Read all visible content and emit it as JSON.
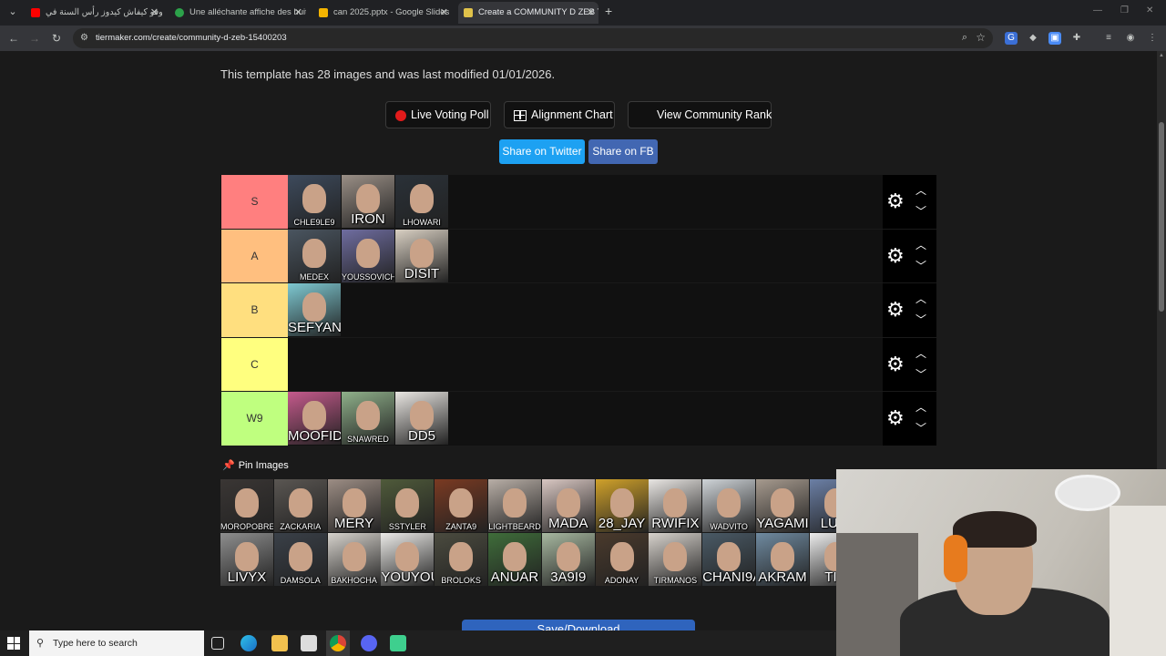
{
  "browser": {
    "tabs": [
      {
        "title": "شوفو كيفاش كيدوز رأس السنة في"
      },
      {
        "title": "Une alléchante affiche des huit"
      },
      {
        "title": "can 2025.pptx - Google Slides"
      },
      {
        "title": "Create a COMMUNITY D ZEB Ti"
      }
    ],
    "url": "tiermaker.com/create/community-d-zeb-15400203"
  },
  "page": {
    "template_info": "This template has 28 images and was last modified 01/01/2026.",
    "buttons": {
      "live_voting": "Live Voting Poll",
      "alignment": "Alignment Chart",
      "community_rank": "View Community Rank",
      "share_twitter": "Share on Twitter",
      "share_fb": "Share on FB"
    },
    "tiers": [
      {
        "label": "S",
        "color": "#ff7f7f",
        "items": [
          {
            "name": "CHLE9LE9",
            "big": false,
            "bg": "#3d4a5c"
          },
          {
            "name": "IRON",
            "big": true,
            "bg": "#9a8f86"
          },
          {
            "name": "LHOWARI",
            "big": false,
            "bg": "#2a3138"
          }
        ]
      },
      {
        "label": "A",
        "color": "#ffbf7f",
        "items": [
          {
            "name": "MEDEX",
            "big": false,
            "bg": "#4a5560"
          },
          {
            "name": "YOUSSOVICH",
            "big": false,
            "bg": "#6f6da0"
          },
          {
            "name": "DISIT",
            "big": true,
            "bg": "#d8cfc2"
          }
        ]
      },
      {
        "label": "B",
        "color": "#ffdf7f",
        "items": [
          {
            "name": "SEFYAN",
            "big": true,
            "bg": "#7ec9d2"
          }
        ]
      },
      {
        "label": "C",
        "color": "#ffff7f",
        "items": []
      },
      {
        "label": "W9",
        "color": "#bfff7f",
        "items": [
          {
            "name": "MOOFID",
            "big": true,
            "bg": "#c55a8c"
          },
          {
            "name": "SNAWRED",
            "big": false,
            "bg": "#8fb08a"
          },
          {
            "name": "DD5",
            "big": true,
            "bg": "#e9e6e2"
          }
        ]
      }
    ],
    "pin_images_label": "Pin Images",
    "pool": [
      {
        "name": "MOROPOBRE",
        "big": false,
        "bg": "#3a3634"
      },
      {
        "name": "ZACKARIA",
        "big": false,
        "bg": "#5a5652"
      },
      {
        "name": "MERY",
        "big": true,
        "bg": "#9c8d84"
      },
      {
        "name": "SSTYLER",
        "big": false,
        "bg": "#4f5a3a"
      },
      {
        "name": "ZANTA9",
        "big": false,
        "bg": "#7a3a22"
      },
      {
        "name": "LIGHTBEARD",
        "big": false,
        "bg": "#b8aea6"
      },
      {
        "name": "MADA",
        "big": true,
        "bg": "#d9c7c2"
      },
      {
        "name": "28_JAY",
        "big": true,
        "bg": "#d0a12a"
      },
      {
        "name": "RWIFIX",
        "big": true,
        "bg": "#e9e6e3"
      },
      {
        "name": "WADVITO",
        "big": false,
        "bg": "#cfd4d8"
      },
      {
        "name": "YAGAMI",
        "big": true,
        "bg": "#a69a8e"
      },
      {
        "name": "LUCI",
        "big": true,
        "bg": "#6b7fa5"
      },
      {
        "name": "LIVYX",
        "big": true,
        "bg": "#8e8e8e"
      },
      {
        "name": "DAMSOLA",
        "big": false,
        "bg": "#3a4048"
      },
      {
        "name": "BAKHOCHA",
        "big": false,
        "bg": "#d6d2cc"
      },
      {
        "name": "YOUYOU",
        "big": true,
        "bg": "#ecebe8"
      },
      {
        "name": "BROLOKS",
        "big": false,
        "bg": "#4b4b3f"
      },
      {
        "name": "ANUAR",
        "big": true,
        "bg": "#3f6d3a"
      },
      {
        "name": "3A9I9",
        "big": true,
        "bg": "#a7b8a0"
      },
      {
        "name": "ADONAY",
        "big": false,
        "bg": "#4a3a2c"
      },
      {
        "name": "TIRMANOS",
        "big": false,
        "bg": "#d7d2cc"
      },
      {
        "name": "CHANI9A",
        "big": true,
        "bg": "#4a5a66"
      },
      {
        "name": "AKRAM",
        "big": true,
        "bg": "#6f8aa0"
      },
      {
        "name": "TIG",
        "big": true,
        "bg": "#ececec"
      }
    ],
    "save_label": "Save/Download"
  },
  "taskbar": {
    "search_placeholder": "Type here to search"
  },
  "colors": {
    "twitter": "#1da1f2",
    "facebook": "#4267b2",
    "save": "#2f64bd"
  }
}
